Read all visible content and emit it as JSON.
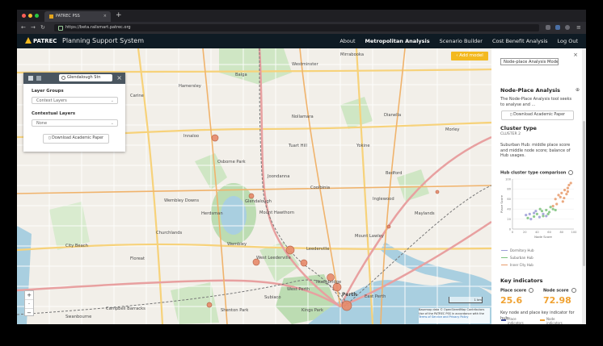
{
  "browser": {
    "tab_title": "PATREC PSS",
    "url": "https://beta.railsmart.patrec.org",
    "new_tab": "+",
    "close": "×"
  },
  "app": {
    "logo": "PATREC",
    "title": "Planning Support System",
    "nav": [
      "About",
      "Metropolitan Analysis",
      "Scenario Builder",
      "Cost Benefit Analysis",
      "Log Out"
    ],
    "active_nav": "Metropolitan Analysis"
  },
  "layer_panel": {
    "search_value": "Glendalough Stn",
    "layer_groups_label": "Layer Groups",
    "layer_groups_value": "Context Layers",
    "contextual_label": "Contextual Layers",
    "contextual_value": "None",
    "download_label": "Download Academic Paper"
  },
  "map": {
    "add_model_label": "Add model",
    "zoom_in": "+",
    "zoom_out": "−",
    "scale_label": "1 km",
    "attribution_line1": "Basemap data © OpenStreetMap Contributors",
    "attribution_line2": "Use of the PATREC PSS in accordance with the",
    "attribution_line3": "Terms of Service and Privacy Policy",
    "places": [
      "Mirrabooka",
      "Westminster",
      "Balga",
      "Hamersley",
      "Carine",
      "Innaloo",
      "Nollamara",
      "Dianella",
      "Morley",
      "Tuart Hill",
      "Yokine",
      "Osborne Park",
      "Joondanna",
      "Bedford",
      "Coolbinia",
      "Inglewood",
      "Wembley Downs",
      "Herdsman",
      "Glendalough",
      "Mount Hawthorn",
      "Maylands",
      "Mount Lawley",
      "Wembley",
      "West Leederville",
      "Leederville",
      "Northbridge",
      "Perth",
      "East Perth",
      "West Perth",
      "Shenton Park",
      "Floreat",
      "Churchlands",
      "City Beach",
      "Subiaco",
      "Kings Park",
      "Campbell Barracks",
      "Swanbourne"
    ]
  },
  "sidebar": {
    "model_select": "Node-place Analysis Model",
    "section_title": "Node-Place Analysis",
    "section_desc": "The Node-Place Analysis tool seeks to analyse and ...",
    "download_label": "Download Academic Paper",
    "cluster_title": "Cluster type",
    "cluster_value": "CLUSTER 2",
    "cluster_desc": "Suburban Hub: middle place score and middle node score; balance of Hub usages.",
    "chart_title": "Hub cluster type comparison",
    "legend": [
      "Dormitory Hub",
      "Suburban Hub",
      "Inner City Hub"
    ],
    "key_title": "Key indicators",
    "place_label": "Place score",
    "place_value": "25.6",
    "node_label": "Node score",
    "node_value": "72.98",
    "key_desc": "Key node and place key indicator for hub",
    "ind_place": "Place indicators",
    "ind_node": "Node indicators"
  },
  "colors": {
    "accent": "#f3b91f",
    "appbar": "#0f1b24",
    "score": "#f0a232",
    "dormitory": "#9b9bd6",
    "suburban": "#7cc27c",
    "inner_city": "#e89a6a"
  },
  "chart_data": {
    "type": "scatter",
    "title": "Hub cluster type comparison",
    "xlabel": "Node Score",
    "ylabel": "Place Score",
    "xlim": [
      0,
      100
    ],
    "ylim": [
      0,
      100
    ],
    "xticks": [
      0,
      20,
      40,
      60,
      80,
      100
    ],
    "yticks": [
      0,
      20,
      40,
      60,
      80,
      100
    ],
    "series": [
      {
        "name": "Dormitory Hub",
        "points": [
          [
            22,
            28
          ],
          [
            30,
            20
          ],
          [
            35,
            32
          ],
          [
            44,
            24
          ],
          [
            50,
            30
          ],
          [
            38,
            36
          ],
          [
            28,
            30
          ],
          [
            55,
            26
          ]
        ]
      },
      {
        "name": "Suburban Hub",
        "points": [
          [
            25,
            22
          ],
          [
            40,
            30
          ],
          [
            48,
            36
          ],
          [
            55,
            38
          ],
          [
            60,
            34
          ],
          [
            62,
            44
          ],
          [
            45,
            40
          ],
          [
            58,
            30
          ],
          [
            66,
            40
          ],
          [
            50,
            26
          ],
          [
            70,
            38
          ],
          [
            35,
            25
          ]
        ]
      },
      {
        "name": "Inner City Hub",
        "points": [
          [
            70,
            60
          ],
          [
            75,
            68
          ],
          [
            80,
            72
          ],
          [
            85,
            78
          ],
          [
            88,
            70
          ],
          [
            90,
            82
          ],
          [
            92,
            88
          ],
          [
            78,
            64
          ],
          [
            84,
            62
          ],
          [
            95,
            92
          ],
          [
            72,
            50
          ],
          [
            66,
            46
          ],
          [
            90,
            75
          ],
          [
            82,
            55
          ]
        ]
      }
    ]
  }
}
